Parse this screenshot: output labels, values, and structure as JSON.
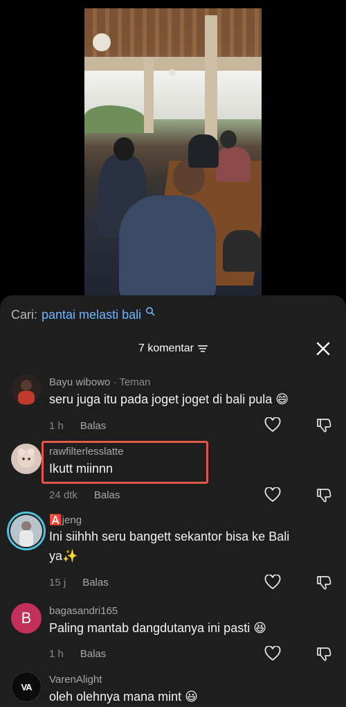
{
  "search": {
    "label": "Cari:",
    "query": "pantai melasti bali"
  },
  "comments_header": {
    "count_label": "7 komentar"
  },
  "comments": [
    {
      "username": "Bayu wibowo",
      "tag": "· Teman",
      "text": "seru juga itu pada joget joget di bali pula 😄",
      "time": "1 h",
      "reply": "Balas"
    },
    {
      "username": "rawfilterlesslatte",
      "text": "Ikutt miinnn",
      "time": "24 dtk",
      "reply": "Balas"
    },
    {
      "username": "🅰️jeng",
      "text": "Ini siihhh seru bangett sekantor bisa ke Bali ya✨",
      "time": "15 j",
      "reply": "Balas"
    },
    {
      "username": "bagasandri165",
      "avatar_letter": "B",
      "text": "Paling mantab dangdutanya ini pasti 😆",
      "time": "1 h",
      "reply": "Balas"
    },
    {
      "username": "VarenAlight",
      "avatar_letter": "VA",
      "text": "oleh olehnya mana mint 😃"
    }
  ],
  "colors": {
    "accent_link": "#6fb6ff",
    "highlight": "#e2574a",
    "sheet_bg": "#1e1e1e"
  }
}
